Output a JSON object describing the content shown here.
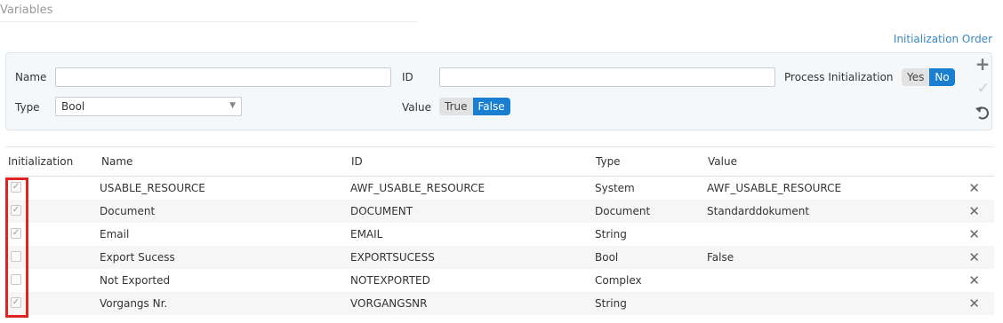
{
  "section": {
    "title": "Variables"
  },
  "header": {
    "initialization_order": "Initialization Order"
  },
  "form": {
    "name_label": "Name",
    "name_value": "",
    "id_label": "ID",
    "id_value": "",
    "process_init_label": "Process Initialization",
    "process_init_yes": "Yes",
    "process_init_no": "No",
    "process_init_selected": "No",
    "type_label": "Type",
    "type_selected": "Bool",
    "value_label": "Value",
    "value_true": "True",
    "value_false": "False",
    "value_selected": "False"
  },
  "actions": {
    "add_icon": "plus-icon",
    "confirm_icon": "check-icon",
    "undo_icon": "undo-icon"
  },
  "table": {
    "columns": [
      "Initialization",
      "Name",
      "ID",
      "Type",
      "Value"
    ],
    "rows": [
      {
        "init": true,
        "name": "USABLE_RESOURCE",
        "id": "AWF_USABLE_RESOURCE",
        "type": "System",
        "value": "AWF_USABLE_RESOURCE"
      },
      {
        "init": true,
        "name": "Document",
        "id": "DOCUMENT",
        "type": "Document",
        "value": "Standarddokument"
      },
      {
        "init": true,
        "name": "Email",
        "id": "EMAIL",
        "type": "String",
        "value": ""
      },
      {
        "init": false,
        "name": "Export Sucess",
        "id": "EXPORTSUCESS",
        "type": "Bool",
        "value": "False"
      },
      {
        "init": false,
        "name": "Not Exported",
        "id": "NOTEXPORTED",
        "type": "Complex",
        "value": ""
      },
      {
        "init": true,
        "name": "Vorgangs Nr.",
        "id": "VORGANGSNR",
        "type": "String",
        "value": ""
      }
    ]
  },
  "colors": {
    "accent": "#1a7fd0",
    "highlight": "#e02323",
    "link": "#3a87c4"
  }
}
